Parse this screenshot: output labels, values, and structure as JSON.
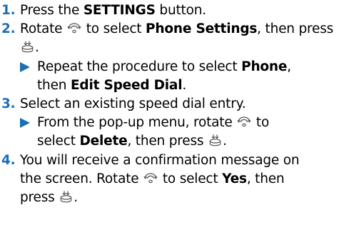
{
  "steps": [
    {
      "number": "1.",
      "parts": [
        "Press the ",
        "SETTINGS",
        " button."
      ]
    },
    {
      "number": "2.",
      "parts": [
        "Rotate ",
        " to select ",
        "Phone Settings",
        ", then press ",
        "."
      ],
      "sub": {
        "parts": [
          "Repeat the procedure to select ",
          "Phone",
          ",",
          "then ",
          "Edit Speed Dial",
          "."
        ]
      }
    },
    {
      "number": "3.",
      "parts": [
        "Select an existing speed dial entry."
      ],
      "sub": {
        "parts": [
          "From the pop-up menu, rotate ",
          " to",
          "select ",
          "Delete",
          ", then press ",
          "."
        ]
      }
    },
    {
      "number": "4.",
      "parts": [
        "You will receive a confirmation message on",
        "the screen. Rotate ",
        " to select ",
        "Yes",
        ", then",
        "press ",
        "."
      ]
    }
  ],
  "icons": {
    "rotate": "interface-dial-rotate-icon",
    "press": "interface-dial-press-icon"
  },
  "colors": {
    "accent": "#1a6fb5",
    "text": "#000000",
    "icon": "#555555"
  }
}
